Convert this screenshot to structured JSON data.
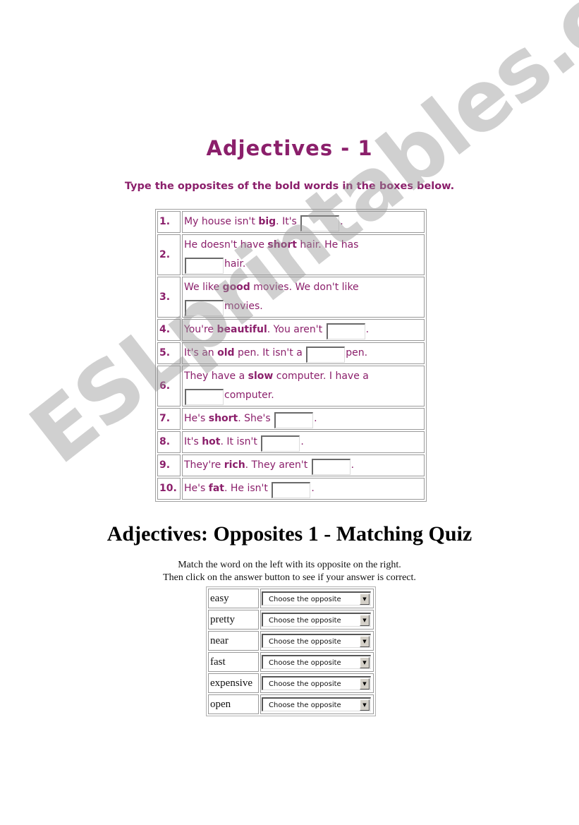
{
  "watermark": "ESLprintables.com",
  "exercise1": {
    "title": "Adjectives - 1",
    "instruction": "Type the opposites of the bold words in the boxes below.",
    "items": [
      {
        "num": "1.",
        "before": "My house isn't ",
        "bold": "big",
        "after": ". It's ",
        "end": ".",
        "wrap": false
      },
      {
        "num": "2.",
        "before": "He doesn't have ",
        "bold": "short",
        "after": " hair. He has ",
        "end": "hair.",
        "wrap": true
      },
      {
        "num": "3.",
        "before": "We like ",
        "bold": "good",
        "after": " movies. We don't like ",
        "end": "movies.",
        "wrap": true
      },
      {
        "num": "4.",
        "before": "You're ",
        "bold": "beautiful",
        "after": ". You aren't ",
        "end": ".",
        "wrap": false
      },
      {
        "num": "5.",
        "before": "It's an ",
        "bold": "old",
        "after": " pen. It isn't a ",
        "end": "pen.",
        "wrap": false
      },
      {
        "num": "6.",
        "before": "They have a ",
        "bold": "slow",
        "after": " computer. I have a ",
        "end": "computer.",
        "wrap": true
      },
      {
        "num": "7.",
        "before": "He's ",
        "bold": "short",
        "after": ". She's ",
        "end": ".",
        "wrap": false
      },
      {
        "num": "8.",
        "before": "It's ",
        "bold": "hot",
        "after": ". It isn't ",
        "end": ".",
        "wrap": false
      },
      {
        "num": "9.",
        "before": "They're ",
        "bold": "rich",
        "after": ". They aren't ",
        "end": ".",
        "wrap": false
      },
      {
        "num": "10.",
        "before": "He's ",
        "bold": "fat",
        "after": ". He isn't ",
        "end": ".",
        "wrap": false
      }
    ]
  },
  "exercise2": {
    "title": "Adjectives: Opposites 1 - Matching Quiz",
    "instruction_line1": "Match the word on the left with its opposite on the right.",
    "instruction_line2": "Then click on the answer button to see if your answer is correct.",
    "rows": [
      {
        "word": "easy",
        "selected": "Choose the opposite"
      },
      {
        "word": "pretty",
        "selected": "Choose the opposite"
      },
      {
        "word": "near",
        "selected": "Choose the opposite"
      },
      {
        "word": "fast",
        "selected": "Choose the opposite"
      },
      {
        "word": "expensive",
        "selected": "Choose the opposite"
      },
      {
        "word": "open",
        "selected": "Choose the opposite"
      }
    ]
  },
  "colors": {
    "accent": "#8b1f6b"
  }
}
